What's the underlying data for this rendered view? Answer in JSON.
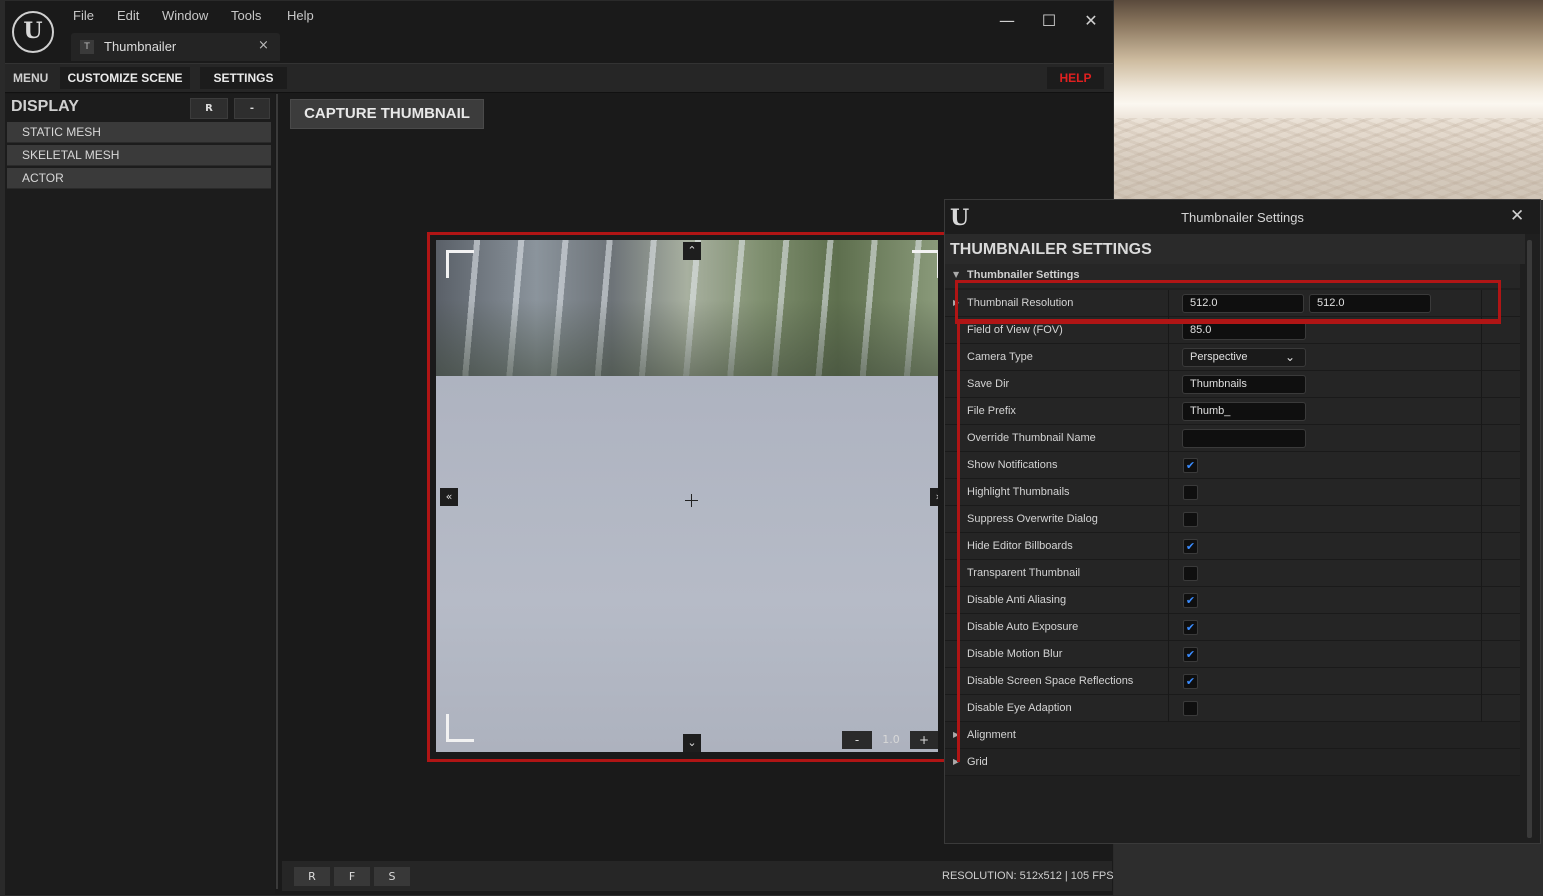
{
  "main_window": {
    "logo": "U",
    "menu": [
      "File",
      "Edit",
      "Window",
      "Tools",
      "Help"
    ],
    "tab": {
      "icon": "T",
      "label": "Thumbnailer",
      "close": "×"
    },
    "window_controls": {
      "minimize": "—",
      "maximize": "☐",
      "close": "✕"
    }
  },
  "toolbar": {
    "menu_label": "MENU",
    "customize_scene": "CUSTOMIZE SCENE",
    "settings": "SETTINGS",
    "help": "HELP",
    "help_color": "#e02020"
  },
  "left_panel": {
    "title": "DISPLAY",
    "reset_button": "R",
    "collapse_button": "-",
    "items": [
      "STATIC MESH",
      "SKELETAL MESH",
      "ACTOR"
    ]
  },
  "viewport": {
    "capture_button": "CAPTURE THUMBNAIL",
    "nav": {
      "up": "⌃",
      "down": "⌄",
      "left": "«",
      "right": "»"
    },
    "zoom": {
      "minus": "-",
      "value": "1.0",
      "plus": "+"
    },
    "highlight_color": "#b01515"
  },
  "bottom_bar": {
    "buttons": [
      "R",
      "F",
      "S"
    ],
    "status": "RESOLUTION: 512x512 | 105 FPS"
  },
  "settings_window": {
    "logo": "U",
    "title": "Thumbnailer Settings",
    "close": "✕",
    "heading": "THUMBNAILER SETTINGS",
    "category": "Thumbnailer Settings",
    "rows": [
      {
        "name": "Thumbnail Resolution",
        "values": [
          "512.0",
          "512.0"
        ],
        "expander": "▶"
      },
      {
        "name": "Field of View (FOV)",
        "value": "85.0"
      },
      {
        "name": "Camera Type",
        "value": "Perspective",
        "dropdown": "⌄"
      },
      {
        "name": "Save Dir",
        "value": "Thumbnails"
      },
      {
        "name": "File Prefix",
        "value": "Thumb_"
      },
      {
        "name": "Override Thumbnail Name",
        "value": ""
      },
      {
        "name": "Show Notifications",
        "checked": true
      },
      {
        "name": "Highlight Thumbnails",
        "checked": false
      },
      {
        "name": "Suppress Overwrite Dialog",
        "checked": false
      },
      {
        "name": "Hide Editor Billboards",
        "checked": true
      },
      {
        "name": "Transparent Thumbnail",
        "checked": false
      },
      {
        "name": "Disable Anti Aliasing",
        "checked": true
      },
      {
        "name": "Disable Auto Exposure",
        "checked": true
      },
      {
        "name": "Disable Motion Blur",
        "checked": true
      },
      {
        "name": "Disable Screen Space Reflections",
        "checked": true
      },
      {
        "name": "Disable Eye Adaption",
        "checked": false
      },
      {
        "name": "Alignment"
      },
      {
        "name": "Grid"
      }
    ],
    "check_mark": "✔",
    "check_color": "#3a8cff"
  }
}
